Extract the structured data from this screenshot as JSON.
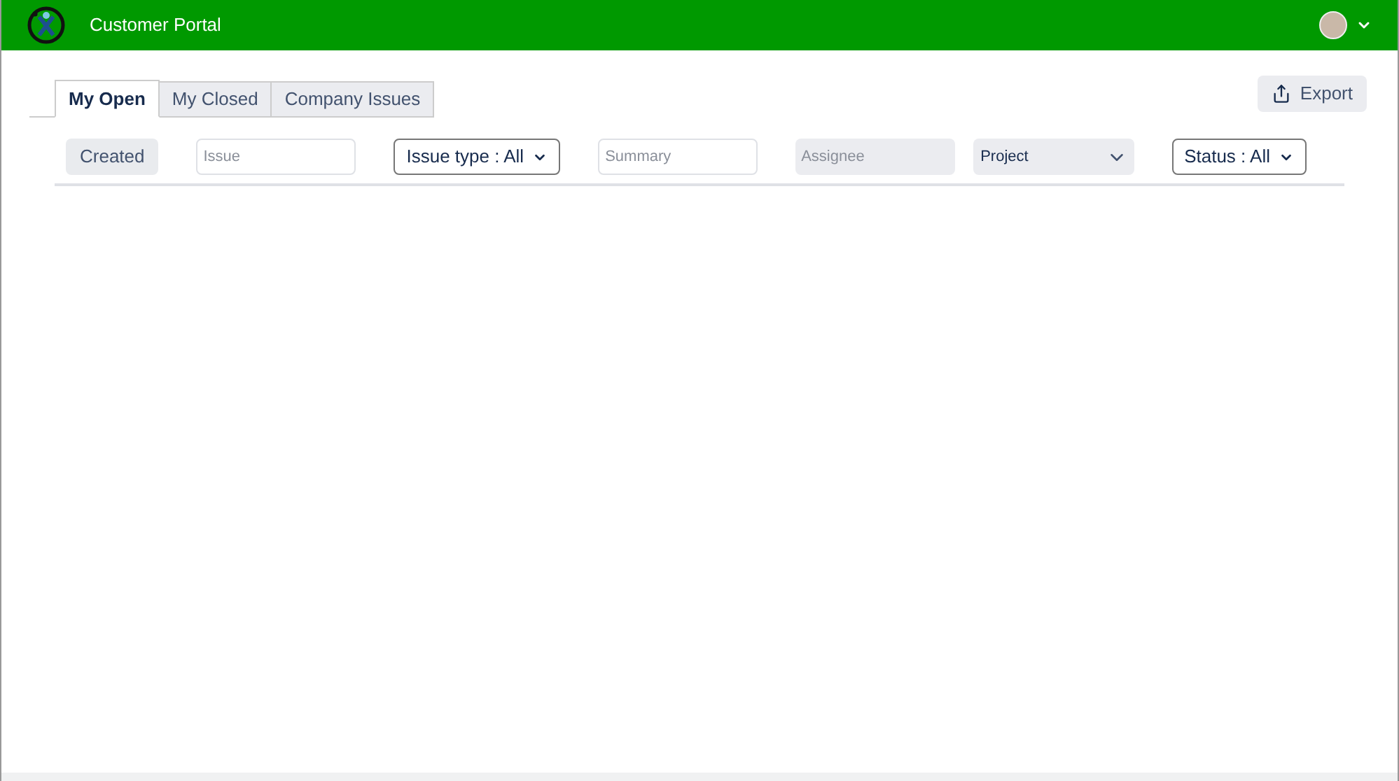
{
  "header": {
    "title": "Customer Portal"
  },
  "tabs": [
    {
      "label": "My Open",
      "selected": true
    },
    {
      "label": "My Closed",
      "selected": false
    },
    {
      "label": "Company Issues",
      "selected": false
    }
  ],
  "export_button": {
    "label": "Export"
  },
  "filters": [
    {
      "kind": "label",
      "text": "Created"
    },
    {
      "kind": "input",
      "placeholder": "Issue"
    },
    {
      "kind": "select",
      "text": "Issue type : All"
    },
    {
      "kind": "input",
      "placeholder": "Summary"
    },
    {
      "kind": "disabled",
      "placeholder": "Assignee"
    },
    {
      "kind": "wide",
      "text": "Project"
    },
    {
      "kind": "select",
      "text": "Status : All"
    }
  ]
}
